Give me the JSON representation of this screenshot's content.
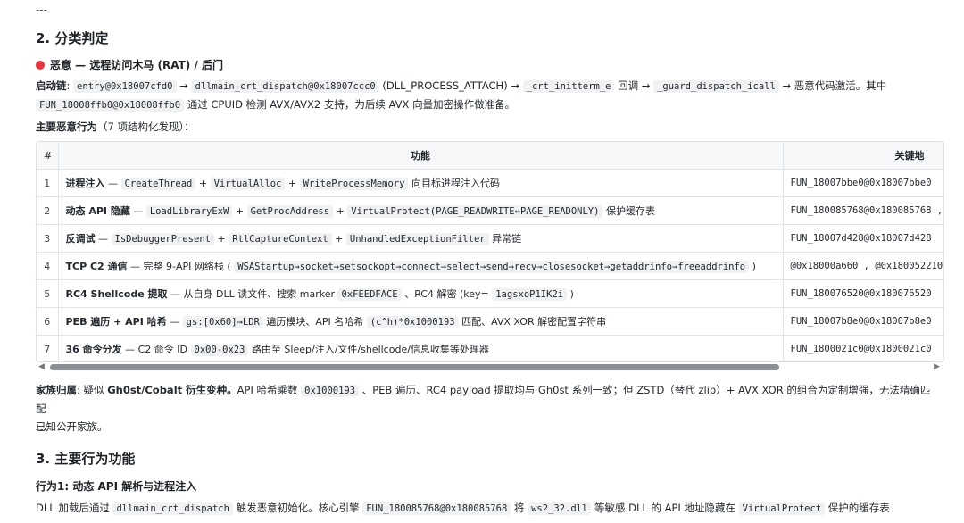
{
  "top_separator": "---",
  "section2": {
    "title": "2. 分类判定",
    "verdict": "恶意 — 远程访问木马 (RAT) / 后门",
    "verdict_color": "#e0383e",
    "boot_chain": {
      "label": "启动链",
      "line1_parts": [
        ": ",
        "entry@0x18007cfd0",
        " → ",
        "dllmain_crt_dispatch@0x18007ccc0",
        " (DLL_PROCESS_ATTACH) → ",
        "_crt_initterm_e",
        " 回调 → ",
        "_guard_dispatch_icall",
        " → 恶意代码激活。其中"
      ],
      "line2_parts": [
        "FUN_18008ffb0@0x18008ffb0",
        " 通过 CPUID 检测 AVX/AVX2 支持，为后续 AVX 向量加密操作做准备。"
      ]
    },
    "main_behaviors": {
      "label": "主要恶意行为",
      "note": "（7 项结构化发现）："
    },
    "table": {
      "headers": [
        "#",
        "功能",
        "关键地"
      ],
      "rows": [
        {
          "num": "1",
          "func": [
            "进程注入",
            " — ",
            "CreateThread",
            " + ",
            "VirtualAlloc",
            " + ",
            "WriteProcessMemory",
            " 向目标进程注入代码"
          ],
          "addr": "FUN_18007bbe0@0x18007bbe0"
        },
        {
          "num": "2",
          "func": [
            "动态 API 隐藏",
            " — ",
            "LoadLibraryExW",
            " + ",
            "GetProcAddress",
            " + ",
            "VirtualProtect(PAGE_READWRITE↔PAGE_READONLY)",
            " 保护缓存表"
          ],
          "addr": "FUN_180085768@0x180085768 ,"
        },
        {
          "num": "3",
          "func": [
            "反调试",
            " — ",
            "IsDebuggerPresent",
            " + ",
            "RtlCaptureContext",
            " + ",
            "UnhandledExceptionFilter",
            " 异常链"
          ],
          "addr": "FUN_18007d428@0x18007d428"
        },
        {
          "num": "4",
          "func": [
            "TCP C2 通信",
            " — 完整 9-API 网络栈 ( ",
            "WSAStartup→socket→setsockopt→connect→select→send→recv→closesocket→getaddrinfo→freeaddrinfo",
            " )"
          ],
          "addr": "@0x18000a660 , @0x180052210"
        },
        {
          "num": "5",
          "func": [
            "RC4 Shellcode 提取",
            " — 从自身 DLL 读文件、搜索 marker ",
            "0xFEEDFACE",
            " 、RC4 解密 (key= ",
            "1agsxoP1IK2i",
            " )"
          ],
          "addr": "FUN_180076520@0x180076520"
        },
        {
          "num": "6",
          "func": [
            "PEB 遍历 + API 哈希",
            " — ",
            "gs:[0x60]→LDR",
            " 遍历模块、API 名哈希 ",
            "(c^h)*0x1000193",
            " 匹配、AVX XOR 解密配置字符串"
          ],
          "addr": "FUN_18007b8e0@0x18007b8e0"
        },
        {
          "num": "7",
          "func": [
            "36 命令分发",
            " — C2 命令 ID ",
            "0x00-0x23",
            " 路由至 Sleep/注入/文件/shellcode/信息收集等处理器"
          ],
          "addr": "FUN_1800021c0@0x1800021c0"
        }
      ]
    },
    "scroll": {
      "left_arrow": "◀",
      "right_arrow": "▶",
      "thumb_fraction": 0.83
    },
    "family": {
      "label": "家族归属",
      "lead": ": 疑似 ",
      "bold": "Gh0st/Cobalt 衍生变种。",
      "parts": [
        "API 哈希乘数 ",
        "0x1000193",
        " 、PEB 遍历、RC4 payload 提取均与 Gh0st 系列一致；但 ZSTD（替代 zlib）+ AVX XOR 的组合为定制增强，无法精确匹配"
      ],
      "line2": "已知公开家族。"
    }
  },
  "mid_separator": "---",
  "section3": {
    "title": "3. 主要行为功能",
    "behavior1_title": "行为1: 动态 API 解析与进程注入",
    "behavior1_parts": [
      "DLL 加载后通过 ",
      "dllmain_crt_dispatch",
      " 触发恶意初始化。核心引擎 ",
      "FUN_180085768@0x180085768",
      " 将 ",
      "ws2_32.dll",
      " 等敏感 DLL 的 API 地址隐藏在 ",
      "VirtualProtect",
      " 保护的缓存表"
    ]
  }
}
